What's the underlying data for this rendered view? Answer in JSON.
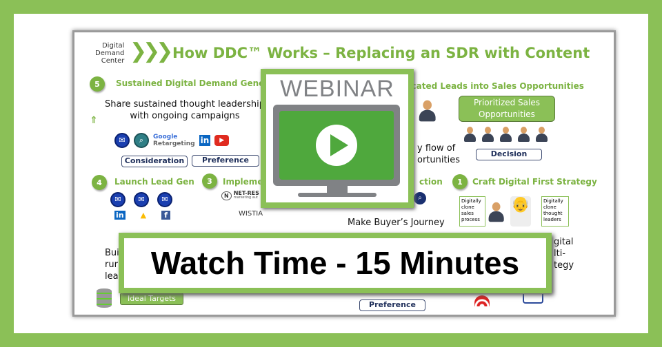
{
  "logo": {
    "line1": "Digital",
    "line2": "Demand",
    "line3": "Center"
  },
  "slide_title": "How DDC™ Works – Replacing an SDR with Content",
  "step5": {
    "number": "5",
    "title": "Sustained Digital Demand Generatio",
    "text1": "Share sustained thought leadership",
    "text2": "with ongoing campaigns",
    "google1": "Google",
    "google2": "Retargeting",
    "stage1": "Consideration",
    "stage2": "Preference"
  },
  "step6": {
    "title": "ucated Leads into Sales Opportunities",
    "text1": "y flow of",
    "text2": "ortunities",
    "box": "Prioritized Sales Opportunities",
    "stage": "Decision"
  },
  "step4": {
    "number": "4",
    "title": "Launch Lead Gen",
    "text1": "Buil",
    "text2": "rur",
    "text3": "leac",
    "targets": "Ideal Targets"
  },
  "step3": {
    "number": "3",
    "title": "Implemer",
    "netresults": "NET-RES",
    "netresults_sub": "marketing aut",
    "wistia": "WISTIA"
  },
  "step2": {
    "title": "ction",
    "text": "Make Buyer’s Journey",
    "stage": "Preference"
  },
  "step1": {
    "number": "1",
    "title": "Craft Digital First Strategy",
    "bubble1": "Digitally clone sales process",
    "bubble2": "Digitally clone thought leaders",
    "text1": "gital",
    "text2": "lti-",
    "text3": "tegy"
  },
  "webinar": {
    "label": "WEBINAR",
    "icon": "play-icon"
  },
  "banner": "Watch Time - 15 Minutes",
  "colors": {
    "brand_green": "#8bc057",
    "title_green": "#7cb342",
    "screen_green": "#4fa83d",
    "monitor_gray": "#808285"
  }
}
